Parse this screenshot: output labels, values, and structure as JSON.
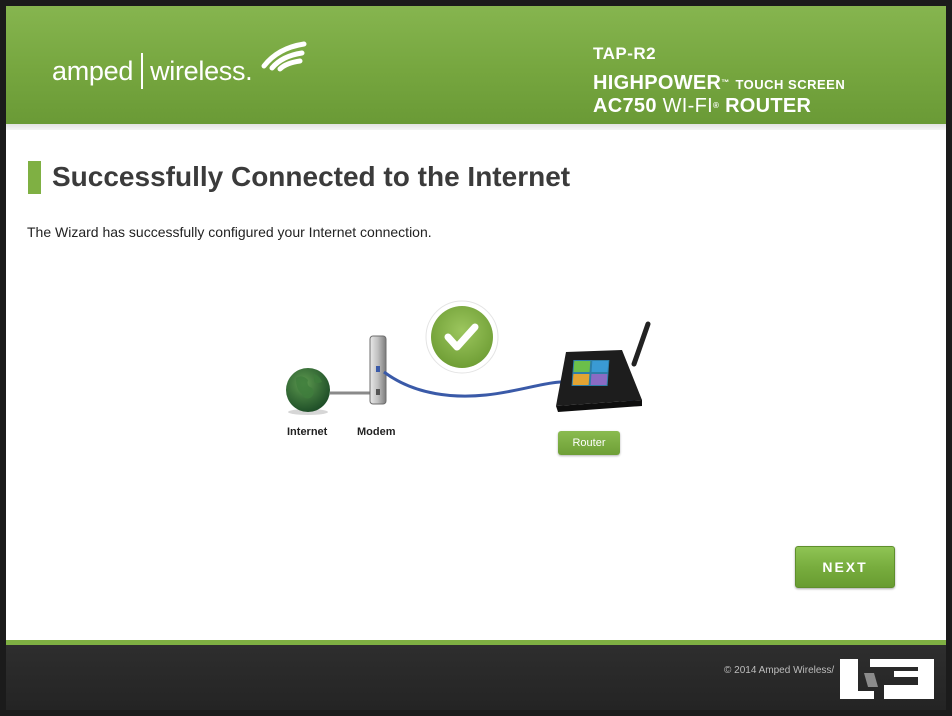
{
  "header": {
    "brand_left": "amped",
    "brand_right": "wireless.",
    "model": "TAP-R2",
    "line2_main": "HIGHPOWER",
    "line2_tm": "™",
    "line2_small": "TOUCH SCREEN",
    "line3_main": "AC750",
    "line3_thin": "WI-FI",
    "line3_reg": "®",
    "line3_end": "ROUTER"
  },
  "page": {
    "title": "Successfully Connected to the Internet",
    "description": "The Wizard has successfully configured your Internet connection."
  },
  "diagram": {
    "internet_label": "Internet",
    "modem_label": "Modem",
    "router_label": "Router"
  },
  "actions": {
    "next_label": "NEXT"
  },
  "footer": {
    "copyright": "© 2014 Amped Wireless/"
  },
  "colors": {
    "brand_green": "#7fb043",
    "header_green": "#76a63f",
    "footer_dark": "#2a2a2a",
    "cable_blue": "#3a5aa8"
  },
  "icons": [
    "wireless-waves-icon",
    "globe-icon",
    "modem-icon",
    "check-circle-icon",
    "router-icon",
    "watermark-logo"
  ]
}
